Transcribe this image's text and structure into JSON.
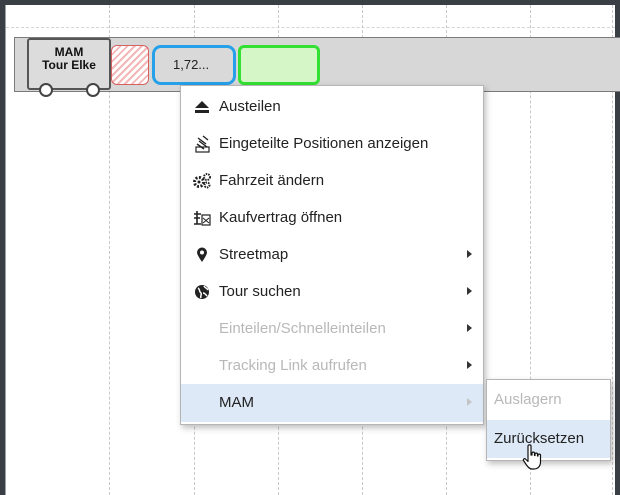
{
  "tour": {
    "truck_line1": "MAM",
    "truck_line2": "Tour Elke",
    "position_value": "1,72..."
  },
  "context_menu": {
    "items": [
      {
        "label": "Austeilen",
        "icon": "eject-icon",
        "enabled": true,
        "submenu": false
      },
      {
        "label": "Eingeteilte Positionen anzeigen",
        "icon": "positions-list-icon",
        "enabled": true,
        "submenu": false
      },
      {
        "label": "Fahrzeit ändern",
        "icon": "cogs-icon",
        "enabled": true,
        "submenu": false
      },
      {
        "label": "Kaufvertrag öffnen",
        "icon": "contract-icon",
        "enabled": true,
        "submenu": false
      },
      {
        "label": "Streetmap",
        "icon": "map-marker-icon",
        "enabled": true,
        "submenu": true
      },
      {
        "label": "Tour suchen",
        "icon": "globe-icon",
        "enabled": true,
        "submenu": true
      },
      {
        "label": "Einteilen/Schnelleinteilen",
        "icon": "",
        "enabled": false,
        "submenu": true
      },
      {
        "label": "Tracking Link aufrufen",
        "icon": "",
        "enabled": false,
        "submenu": true
      },
      {
        "label": "MAM",
        "icon": "",
        "enabled": true,
        "submenu": true,
        "highlighted": true
      }
    ]
  },
  "submenu": {
    "items": [
      {
        "label": "Auslagern",
        "enabled": false
      },
      {
        "label": "Zurücksetzen",
        "enabled": true,
        "highlighted": true
      }
    ]
  },
  "colors": {
    "frame": "#3a3f45",
    "tour_bar": "#d7d7d7",
    "selected_border": "#26a0e8",
    "green_border": "#33e033",
    "green_fill": "#d5f7c8",
    "hatch_red": "#d46060",
    "hover_bg": "#dde9f7",
    "disabled_text": "#b8b8b8"
  }
}
